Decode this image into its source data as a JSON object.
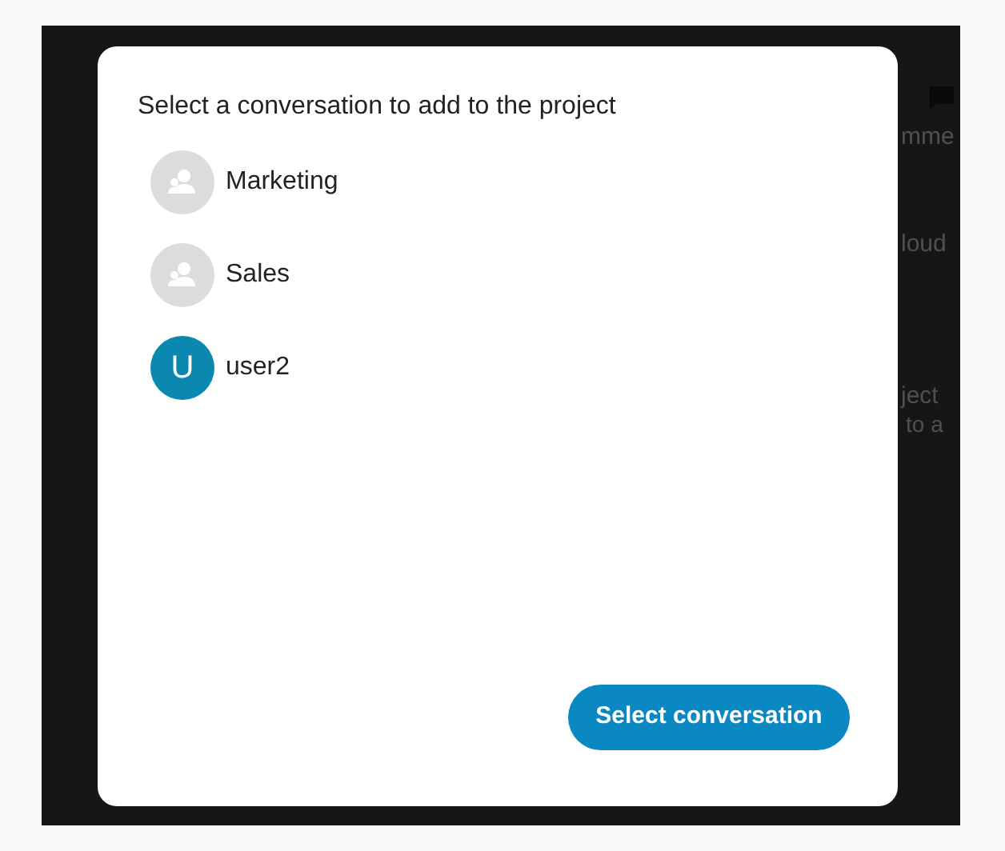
{
  "background": {
    "fragments": [
      "mme",
      "loud",
      "ject",
      "to a"
    ]
  },
  "dialog": {
    "title": "Select a conversation to add to the project",
    "conversations": [
      {
        "name": "Marketing",
        "kind": "group"
      },
      {
        "name": "Sales",
        "kind": "group"
      },
      {
        "name": "user2",
        "kind": "initial",
        "initial": "U"
      }
    ],
    "button": "Select conversation"
  }
}
